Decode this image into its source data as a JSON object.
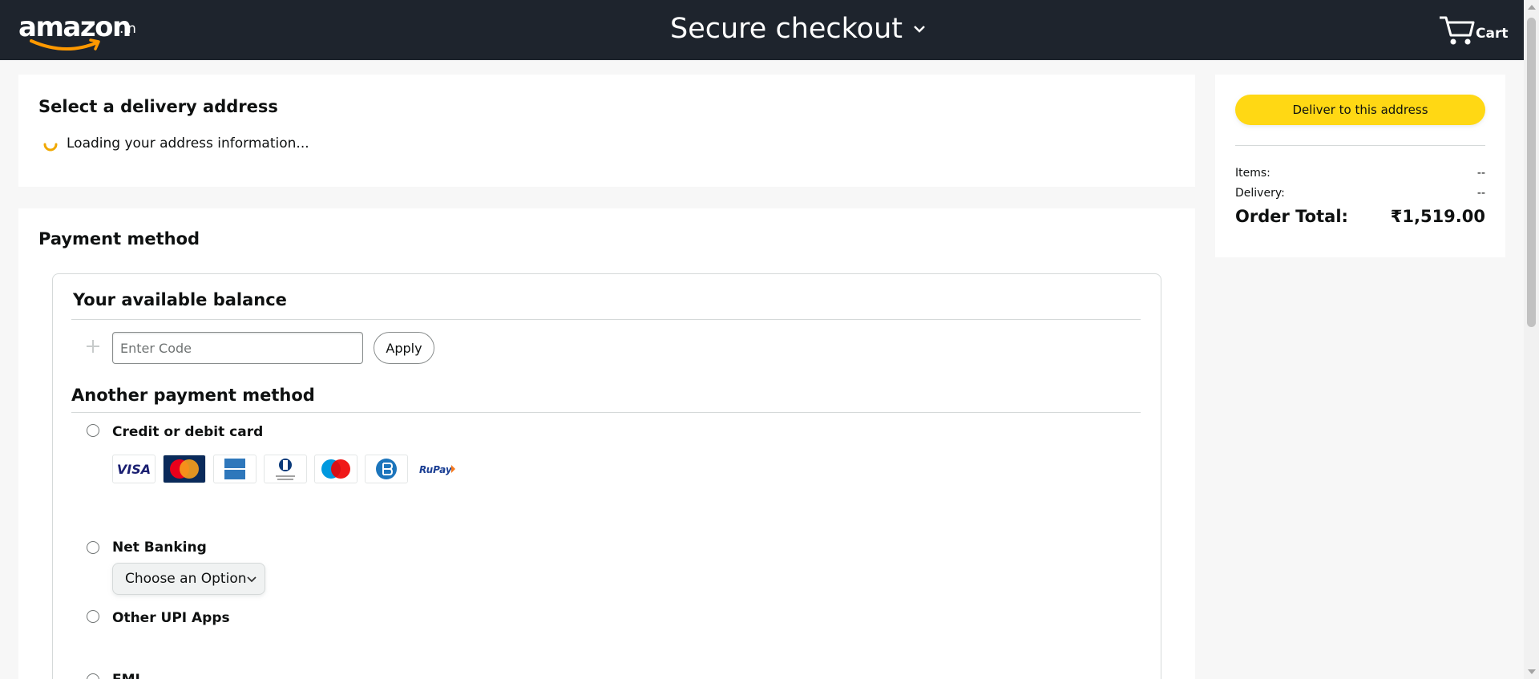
{
  "header": {
    "logo_text": "amazon",
    "logo_suffix": ".in",
    "title": "Secure checkout",
    "cart_label": "Cart"
  },
  "address": {
    "title": "Select a delivery address",
    "loading_text": "Loading your address information..."
  },
  "payment": {
    "title": "Payment method",
    "balance_title": "Your available balance",
    "code_placeholder": "Enter Code",
    "apply_label": "Apply",
    "another_title": "Another payment method",
    "options": [
      {
        "label": "Credit or debit card"
      },
      {
        "label": "Net Banking"
      },
      {
        "label": "Other UPI Apps"
      },
      {
        "label": "EMI"
      }
    ],
    "card_logos": [
      "VISA",
      "MasterCard",
      "American Express",
      "Diners Club International",
      "Maestro",
      "Bajaj Finserv",
      "RuPay"
    ],
    "net_banking_select": "Choose an Option"
  },
  "summary": {
    "deliver_button": "Deliver to this address",
    "items_label": "Items:",
    "items_value": "--",
    "delivery_label": "Delivery:",
    "delivery_value": "--",
    "total_label": "Order Total:",
    "total_value": "₹1,519.00"
  },
  "colors": {
    "header_bg": "#1e242d",
    "accent_yellow": "#ffd814",
    "logo_orange": "#ff9900"
  }
}
